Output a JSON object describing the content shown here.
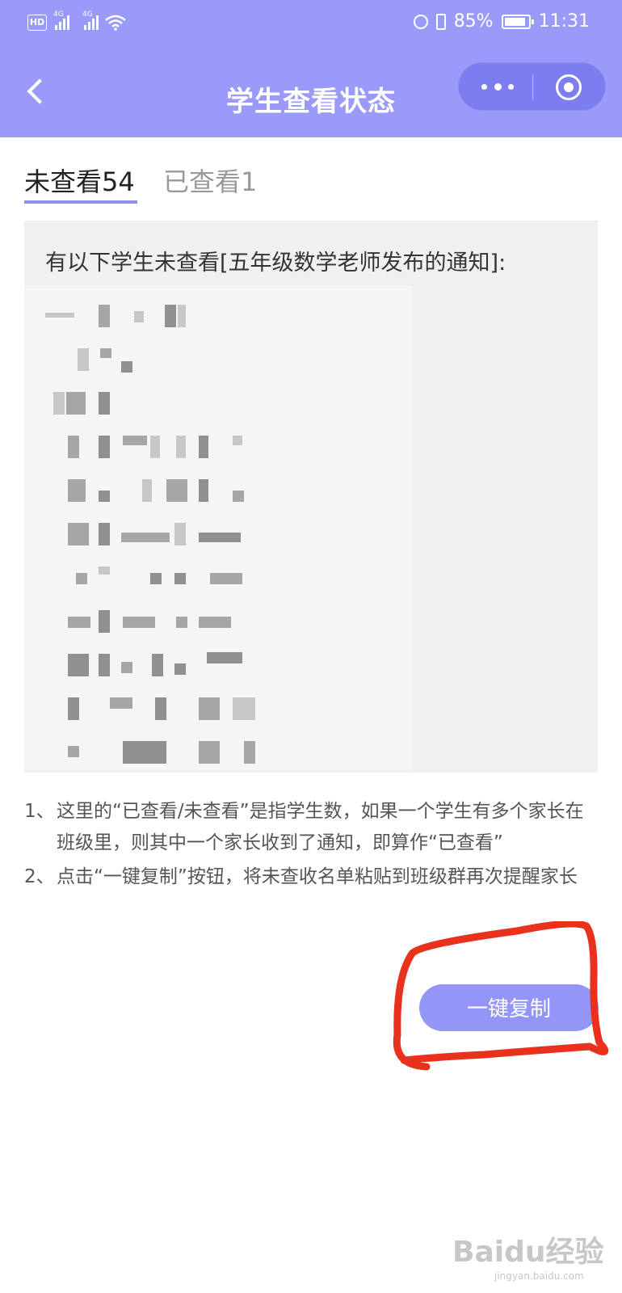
{
  "status_bar": {
    "hd": "HD",
    "signal1_label": "4G",
    "signal2_label": "4G",
    "battery": "85%",
    "time": "11:31"
  },
  "nav": {
    "title": "学生查看状态"
  },
  "tabs": [
    {
      "label": "未查看54",
      "active": true
    },
    {
      "label": "已查看1",
      "active": false
    }
  ],
  "panel": {
    "title": "有以下学生未查看[五年级数学老师发布的通知]:"
  },
  "notes": [
    {
      "num": "1、",
      "text": "这里的“已查看/未查看”是指学生数，如果一个学生有多个家长在班级里，则其中一个家长收到了通知，即算作“已查看”"
    },
    {
      "num": "2、",
      "text": "点击“一键复制”按钮，将未查收名单粘贴到班级群再次提醒家长"
    }
  ],
  "copy_button": {
    "label": "一键复制"
  },
  "watermark": {
    "text": "Baidu经验",
    "sub": "jingyan.baidu.com"
  },
  "colors": {
    "header": "#9a9bf9",
    "accent": "#8c8ef0",
    "annotation": "#e8321e"
  }
}
